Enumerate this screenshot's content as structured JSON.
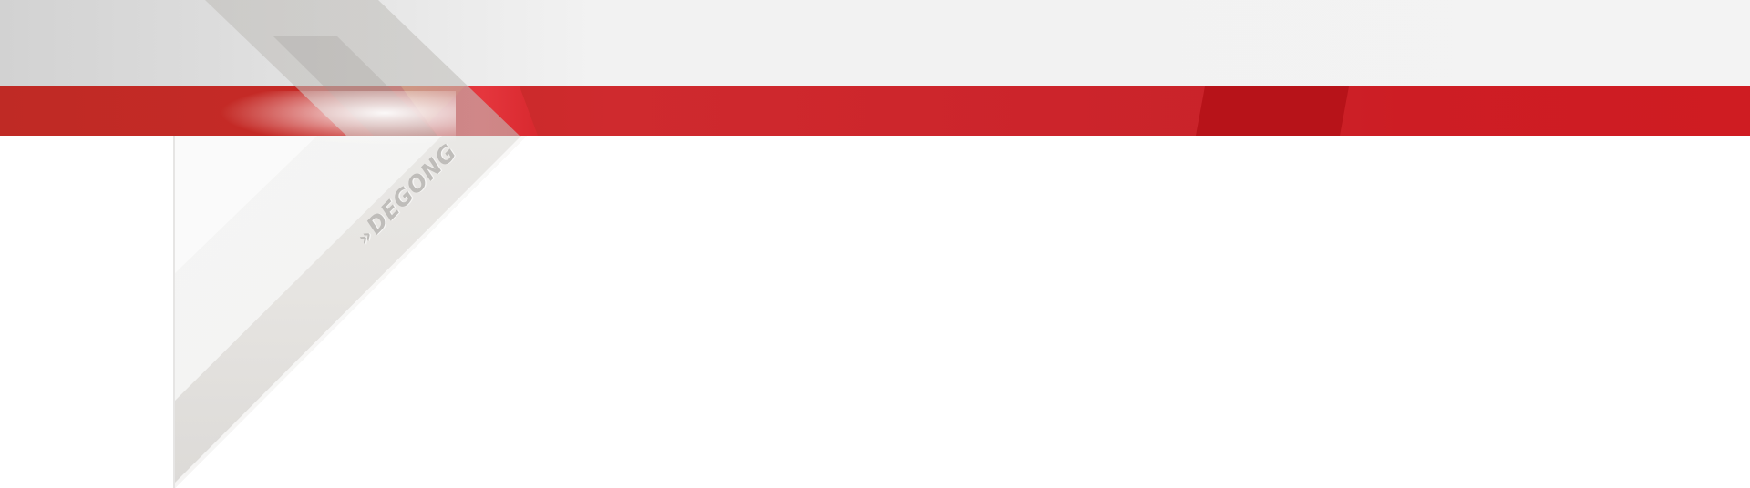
{
  "banner": {
    "brand_logo_text": "DEGONG",
    "colors": {
      "top_band": "#f3f3f3",
      "red_band": "#cc242b",
      "red_band_dark": "#b71319",
      "chevron_grey": "#e6e4e1",
      "background": "#ffffff"
    }
  }
}
